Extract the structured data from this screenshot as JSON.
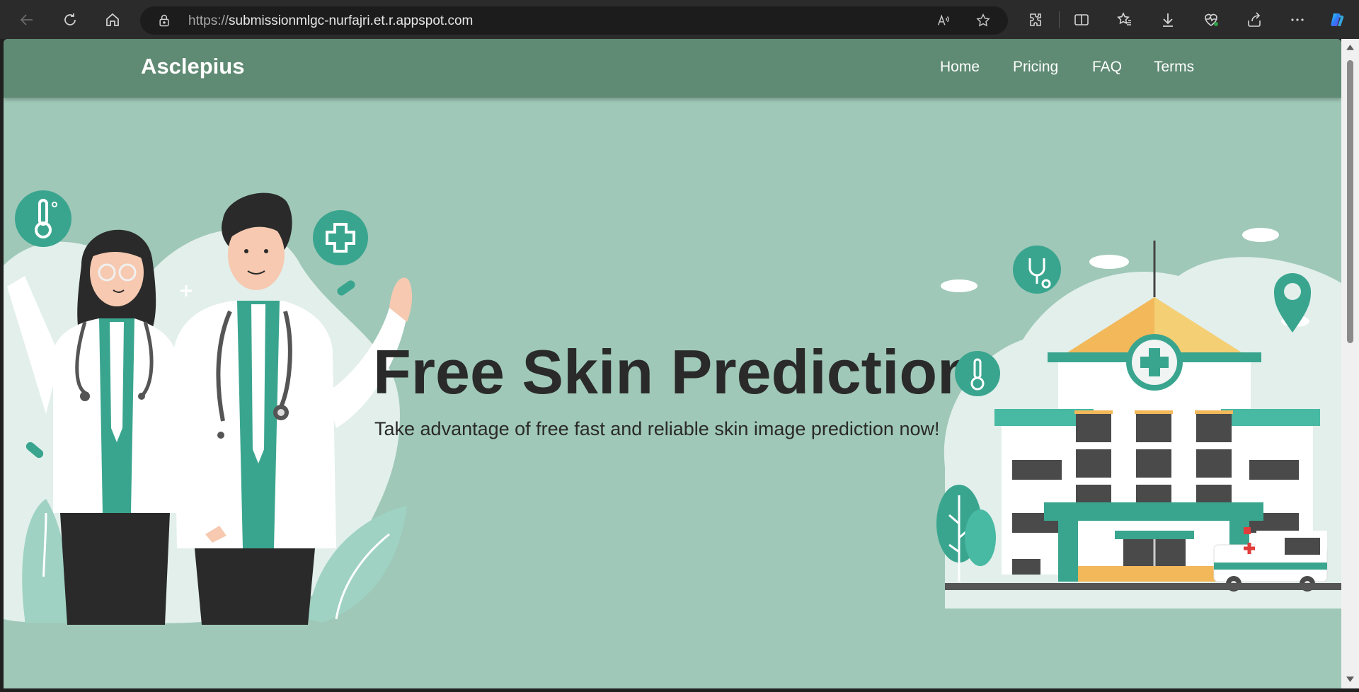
{
  "browser": {
    "url_protocol": "https://",
    "url_host": "submissionmlgc-nurfajri.et.r.appspot.com",
    "icons": [
      "back-icon",
      "refresh-icon",
      "home-icon",
      "lock-icon",
      "read-aloud-icon",
      "favorite-star-icon",
      "extensions-icon",
      "split-screen-icon",
      "favorites-icon",
      "downloads-icon",
      "browser-essentials-icon",
      "share-icon",
      "more-icon",
      "copilot-icon"
    ]
  },
  "site": {
    "brand": "Asclepius",
    "nav": [
      "Home",
      "Pricing",
      "FAQ",
      "Terms"
    ]
  },
  "hero": {
    "title": "Free Skin Prediction",
    "subtitle": "Take advantage of free fast and reliable skin image prediction now!"
  },
  "colors": {
    "header_bg": "#5f8a73",
    "page_bg": "#9fc8b8",
    "accent_teal": "#3aa58f",
    "dark_text": "#2a2a2a"
  }
}
